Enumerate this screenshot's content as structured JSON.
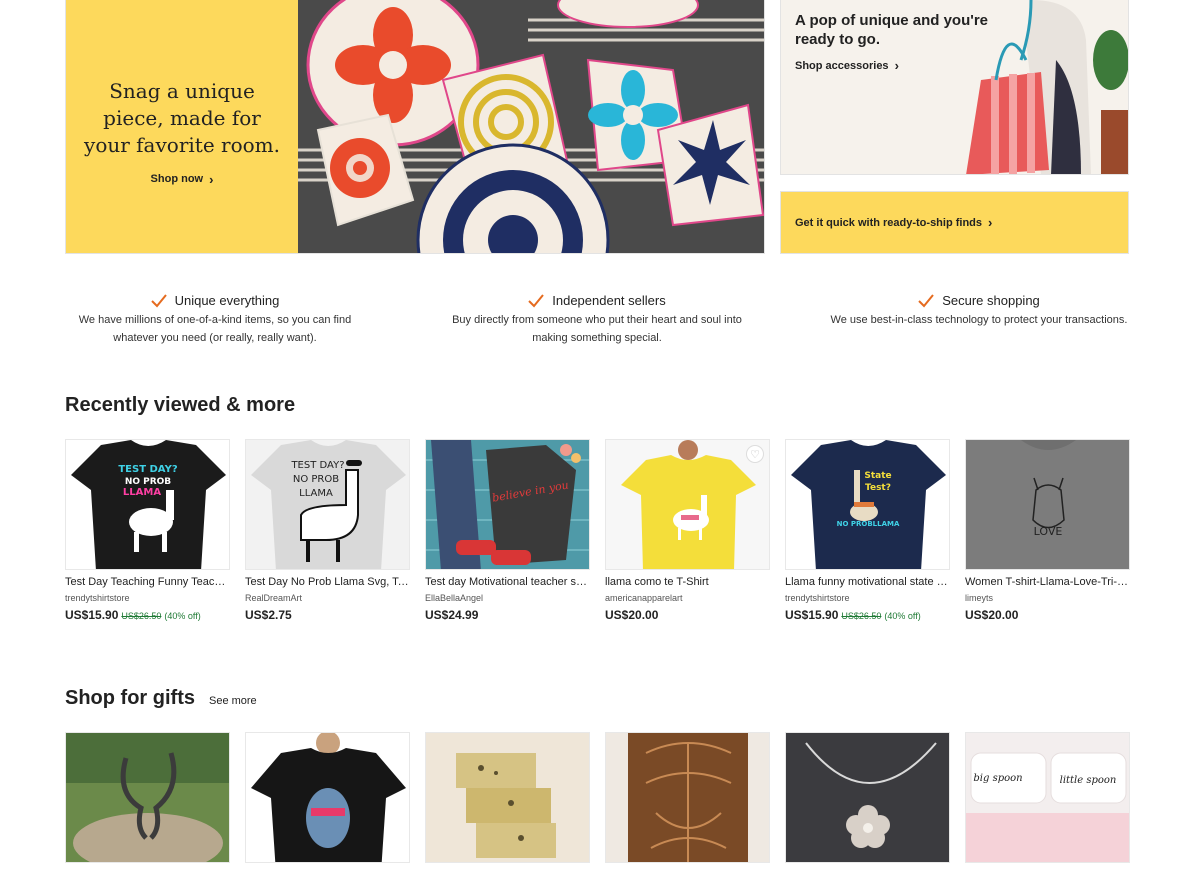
{
  "hero": {
    "main": {
      "headline": "Snag a unique piece, made for your favorite room.",
      "link": "Shop now"
    },
    "side_top": {
      "title": "A pop of unique and you're ready to go.",
      "link": "Shop accessories"
    },
    "side_bottom": {
      "link": "Get it quick with ready-to-ship finds"
    },
    "colors": {
      "accent": "#fdd95c"
    }
  },
  "value_props": [
    {
      "title": "Unique everything",
      "desc": "We have millions of one-of-a-kind items, so you can find whatever you need (or really, really want)."
    },
    {
      "title": "Independent sellers",
      "desc": "Buy directly from someone who put their heart and soul into making something special."
    },
    {
      "title": "Secure shopping",
      "desc": "We use best-in-class technology to protect your transactions."
    }
  ],
  "recently_viewed": {
    "title": "Recently viewed & more",
    "items": [
      {
        "title": "Test Day Teaching Funny Teacher Shirt",
        "shop": "trendytshirtstore",
        "price": "US$15.90",
        "original": "US$26.50",
        "discount": "(40% off)"
      },
      {
        "title": "Test Day No Prob Llama Svg, Teacher Svg",
        "shop": "RealDreamArt",
        "price": "US$2.75",
        "original": "",
        "discount": ""
      },
      {
        "title": "Test day Motivational teacher shirt",
        "shop": "EllaBellaAngel",
        "price": "US$24.99",
        "original": "",
        "discount": ""
      },
      {
        "title": "llama como te T-Shirt",
        "shop": "americanapparelart",
        "price": "US$20.00",
        "original": "",
        "discount": ""
      },
      {
        "title": "Llama funny motivational state test shirt",
        "shop": "trendytshirtstore",
        "price": "US$15.90",
        "original": "US$26.50",
        "discount": "(40% off)"
      },
      {
        "title": "Women T-shirt-Llama-Love-Tri-Blend",
        "shop": "limeyts",
        "price": "US$20.00",
        "original": "",
        "discount": ""
      }
    ]
  },
  "gifts": {
    "title": "Shop for gifts",
    "see_more": "See more"
  },
  "thumb_text": {
    "t1a": "TEST DAY?",
    "t1b": "NO PROB",
    "t1c": "LLAMA",
    "t2a": "TEST DAY?",
    "t2b": "NO PROB",
    "t2c": "LLAMA",
    "t3": "believe in you",
    "t5a": "State",
    "t5b": "Test?",
    "t5c": "NO PROBLLAMA",
    "t6": "LOVE",
    "g6a": "big spoon",
    "g6b": "little spoon"
  }
}
